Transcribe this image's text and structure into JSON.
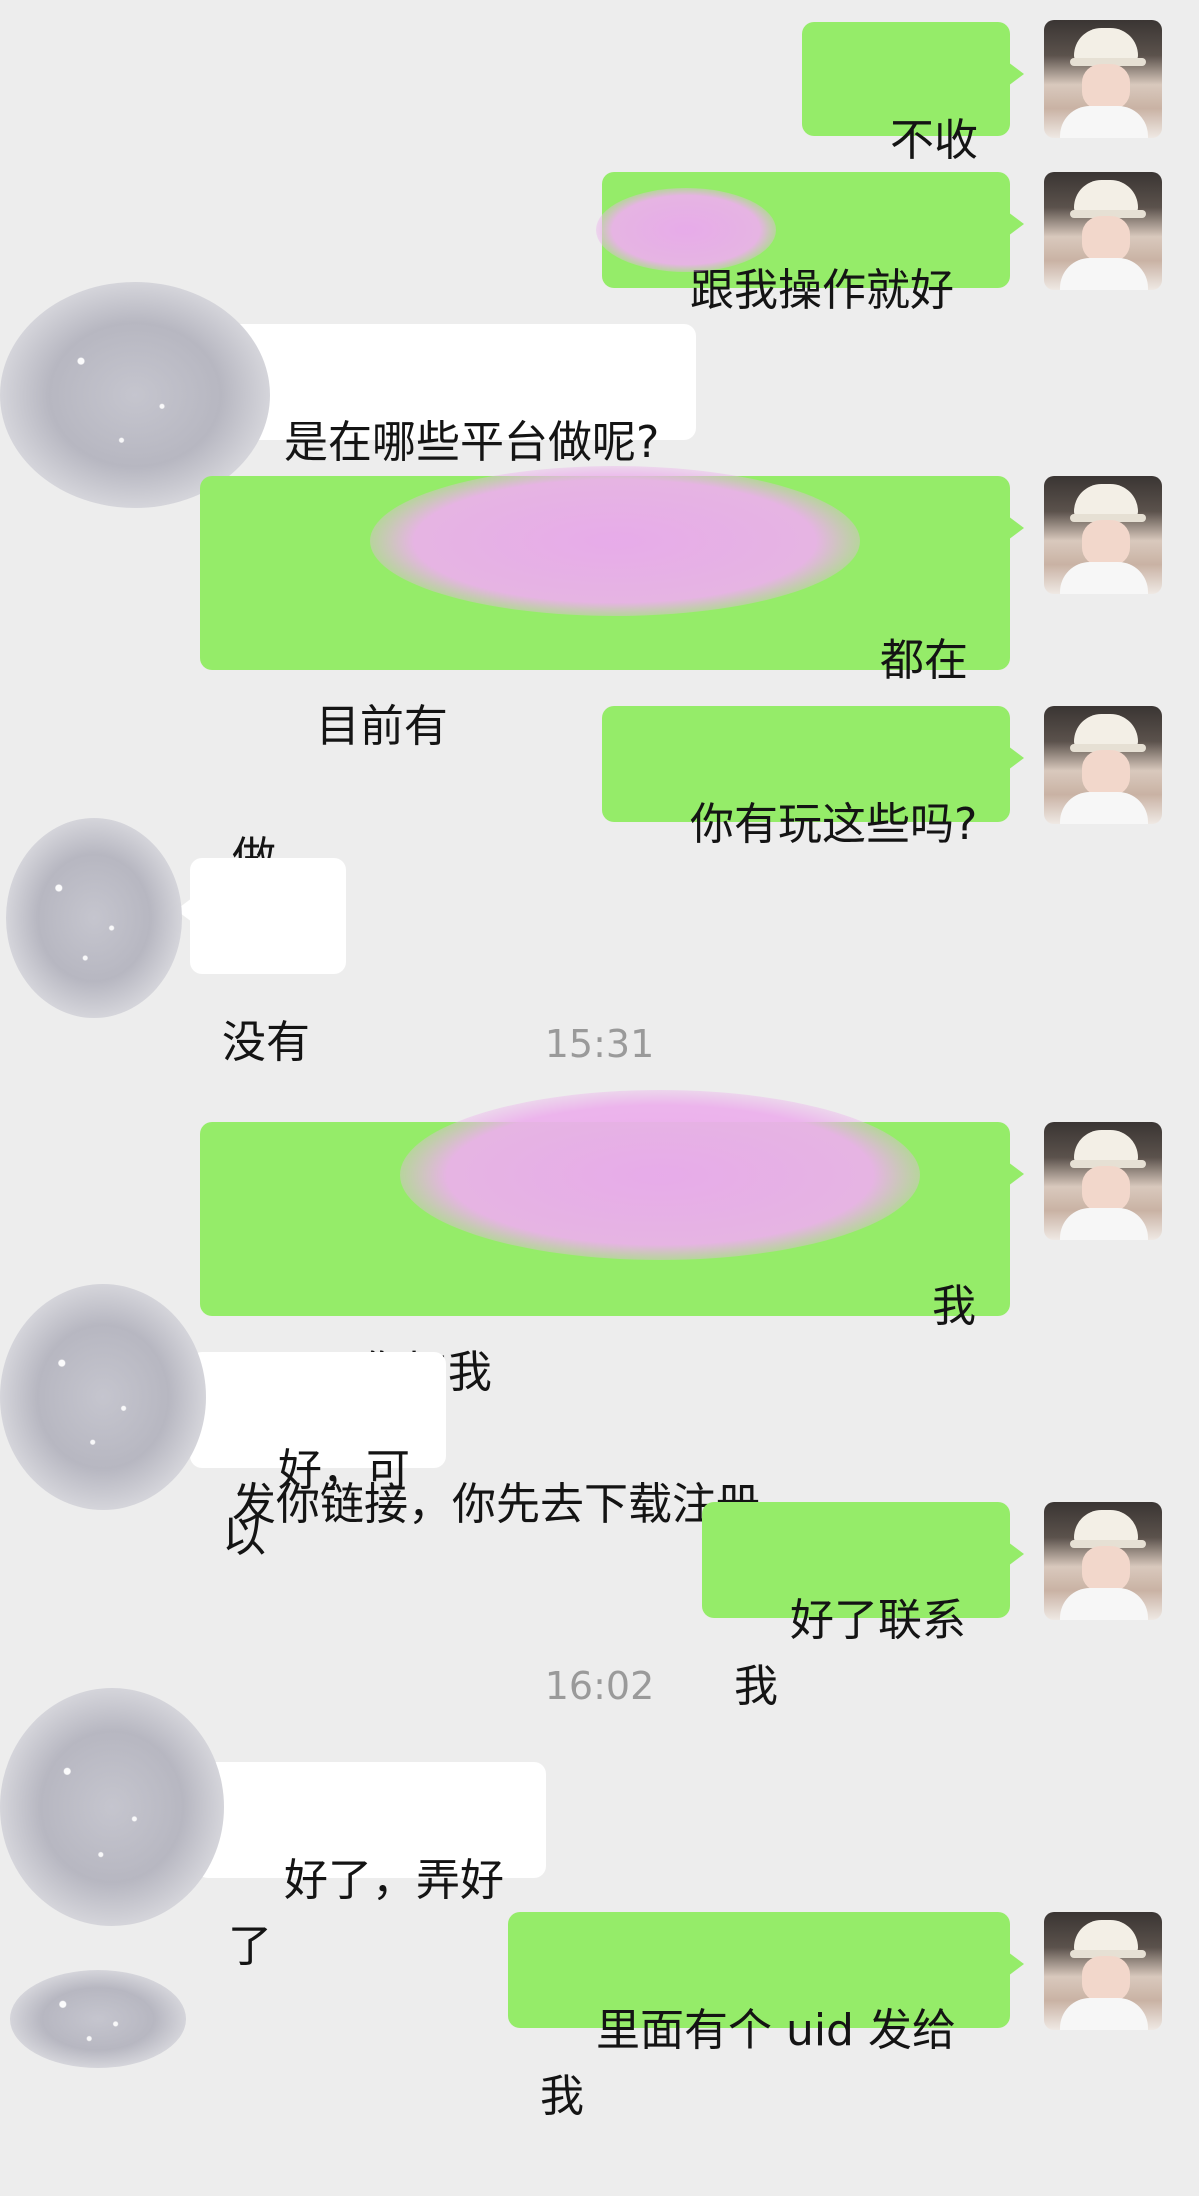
{
  "chat": {
    "messages": [
      {
        "side": "me",
        "text": "不收费"
      },
      {
        "side": "me",
        "text": "跟我操作就好了"
      },
      {
        "side": "other",
        "text": "是在哪些平台做呢?"
      },
      {
        "side": "me",
        "text_line1_start": "目前有",
        "text_line1_end": "都在",
        "text_line2": "做"
      },
      {
        "side": "me",
        "text": "你有玩这些吗?"
      },
      {
        "side": "other",
        "text": "没有"
      },
      {
        "side": "me",
        "text_line1_start": "那你加我",
        "text_line1_end": "我",
        "text_line2": "发你链接，你先去下载注册"
      },
      {
        "side": "other",
        "text": "好，可以"
      },
      {
        "side": "me",
        "text": "好了联系我"
      },
      {
        "side": "other",
        "text": "好了，弄好了"
      },
      {
        "side": "me",
        "text": "里面有个 uid 发给我"
      }
    ],
    "timestamps": [
      "15:31",
      "16:02"
    ]
  },
  "colors": {
    "background": "#ededed",
    "my_bubble": "#95ec69",
    "their_bubble": "#ffffff",
    "redaction": "#e9aaec"
  }
}
